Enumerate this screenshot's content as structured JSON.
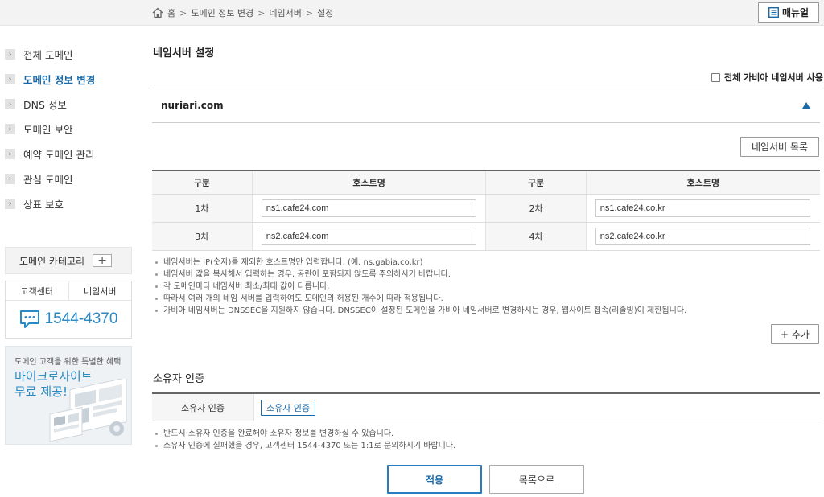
{
  "breadcrumb": {
    "items": [
      "홈",
      "도메인 정보 변경",
      "네임서버",
      "설정"
    ],
    "separator": ">"
  },
  "header": {
    "manual_label": "매뉴얼"
  },
  "sidebar": {
    "items": [
      {
        "label": "전체 도메인",
        "active": false
      },
      {
        "label": "도메인 정보 변경",
        "active": true
      },
      {
        "label": "DNS 정보",
        "active": false
      },
      {
        "label": "도메인 보안",
        "active": false
      },
      {
        "label": "예약 도메인 관리",
        "active": false
      },
      {
        "label": "관심 도메인",
        "active": false
      },
      {
        "label": "상표 보호",
        "active": false
      }
    ],
    "category_label": "도메인 카테고리",
    "category_add": "+",
    "support": {
      "tab_support": "고객센터",
      "tab_nameserver": "네임서버",
      "phone": "1544-4370"
    },
    "promo": {
      "small": "도메인 고객을 위한 특별한 혜택",
      "line1": "마이크로사이트",
      "line2": "무료 제공!"
    }
  },
  "main": {
    "title": "네임서버 설정",
    "all_ns_label": "전체 가비아 네임서버 사용",
    "domain": "nuriari.com",
    "ns_list_button": "네임서버 목록",
    "table": {
      "headers": [
        "구분",
        "호스트명",
        "구분",
        "호스트명"
      ],
      "rows": [
        {
          "label_a": "1차",
          "host_a": "ns1.cafe24.com",
          "label_b": "2차",
          "host_b": "ns1.cafe24.co.kr"
        },
        {
          "label_a": "3차",
          "host_a": "ns2.cafe24.com",
          "label_b": "4차",
          "host_b": "ns2.cafe24.co.kr"
        }
      ]
    },
    "notes": [
      "네임서버는 IP(숫자)를 제외한 호스트명만 입력합니다. (예. ns.gabia.co.kr)",
      "네임서버 값을 복사해서 입력하는 경우, 공란이 포함되지 않도록 주의하시기 바랍니다.",
      "각 도메인마다 네임서버 최소/최대 값이 다릅니다.",
      "따라서 여러 개의 네임 서버를 입력하여도 도메인의 허용된 개수에 따라 적용됩니다.",
      "가비아 네임서버는 DNSSEC을 지원하지 않습니다. DNSSEC이 설정된 도메인을 가비아 네임서버로 변경하시는 경우, 웹사이트 접속(리졸빙)이 제한됩니다."
    ],
    "add_button": "+ 추가",
    "owner": {
      "title": "소유자 인증",
      "label": "소유자 인증",
      "button": "소유자 인증",
      "notes": [
        "반드시 소유자 인증을 완료해야 소유자 정보를 변경하실 수 있습니다.",
        "소유자 인증에 실패했을 경우, 고객센터 1544-4370 또는 1:1로 문의하시기 바랍니다."
      ]
    },
    "apply_button": "적용",
    "list_button": "목록으로"
  },
  "colors": {
    "accent": "#1a6aa8",
    "phone": "#2a8ac4"
  }
}
